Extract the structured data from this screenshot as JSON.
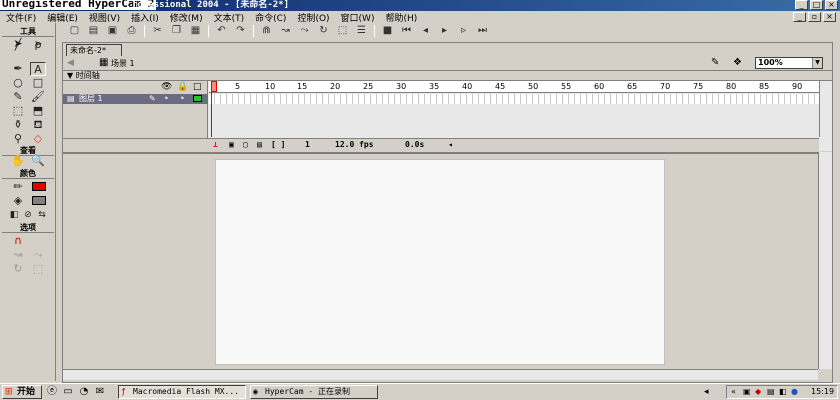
{
  "window": {
    "watermark": "Unregistered HyperCam 2",
    "title": "rofessional 2004 - [未命名-2*]",
    "min": "_",
    "max": "□",
    "close": "×"
  },
  "menu": [
    "文件(F)",
    "编辑(E)",
    "视图(V)",
    "插入(I)",
    "修改(M)",
    "文本(T)",
    "命令(C)",
    "控制(O)",
    "窗口(W)",
    "帮助(H)"
  ],
  "toolbar_icons": [
    "new",
    "open",
    "save",
    "print",
    "cut",
    "copy",
    "paste",
    "undo",
    "redo",
    "snap",
    "smooth",
    "straighten",
    "rotate",
    "scale",
    "align",
    "stop",
    "rewind",
    "step-back",
    "play",
    "step-forward",
    "end"
  ],
  "tools": {
    "section_tools": "工具",
    "section_view": "查看",
    "section_colors": "颜色",
    "section_options": "选项"
  },
  "document": {
    "tab": "未命名-2*",
    "scene": "场景 1",
    "zoom": "100%",
    "timeline_label": "时间轴"
  },
  "timeline": {
    "layer_name": "图层 1",
    "ruler": [
      "1",
      "5",
      "10",
      "15",
      "20",
      "25",
      "30",
      "35",
      "40",
      "45",
      "50",
      "55",
      "60",
      "65",
      "70",
      "75",
      "80",
      "85",
      "90"
    ],
    "current_frame": "1",
    "frame_rate": "12.0 fps",
    "elapsed": "0.0s"
  },
  "taskbar": {
    "start": "开始",
    "tasks": [
      "Macromedia Flash MX...",
      "HyperCam - 正在录制"
    ],
    "clock": "15:19"
  }
}
